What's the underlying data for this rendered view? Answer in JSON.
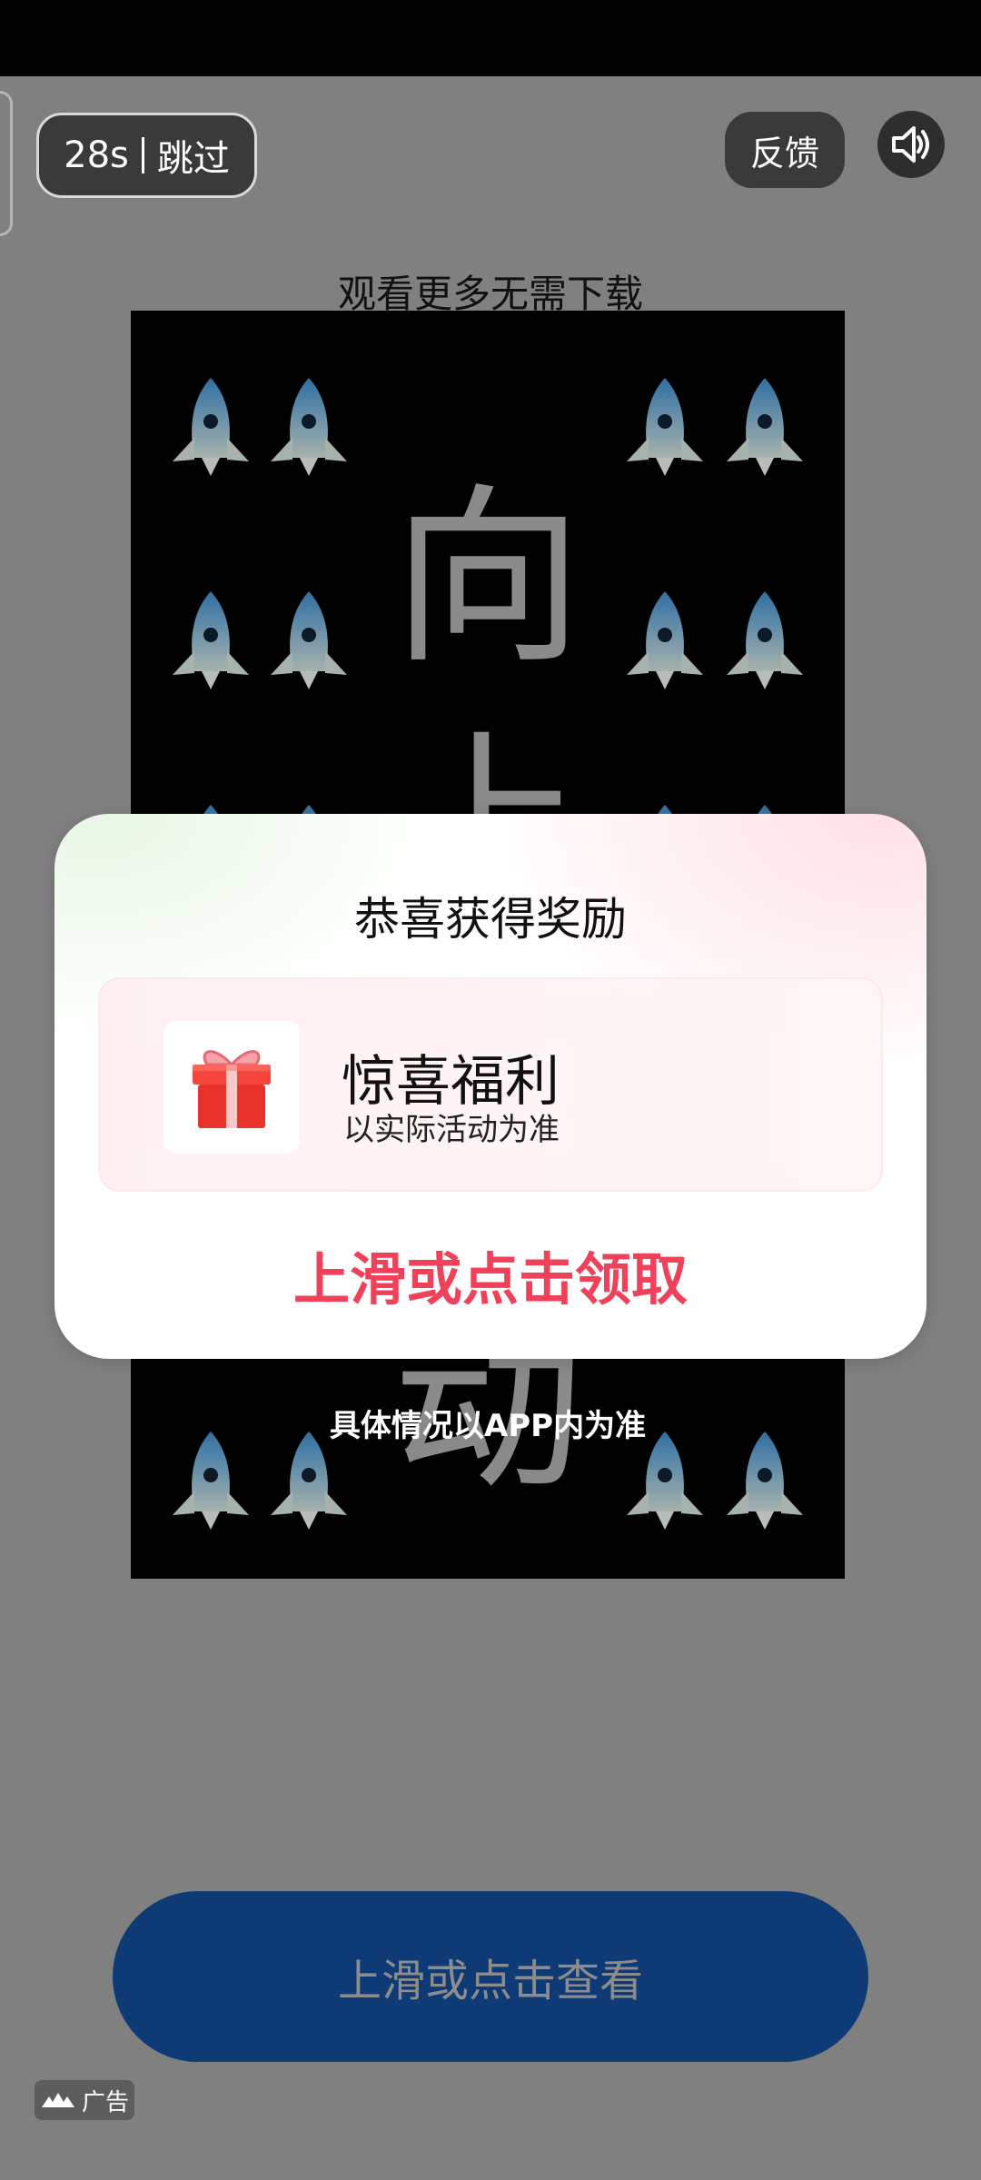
{
  "top_bar": {
    "countdown": "28s",
    "skip_label": "跳过",
    "feedback_label": "反馈",
    "sound_icon": "speaker-icon"
  },
  "watch_more_text": "观看更多无需下载",
  "video": {
    "big_chars": [
      "向",
      "上",
      "动"
    ],
    "note": "具体情况以APP内为准",
    "decoration_icon": "rocket-icon"
  },
  "modal": {
    "title": "恭喜获得奖励",
    "reward_name": "惊喜福利",
    "reward_desc": "以实际活动为准",
    "reward_icon": "gift-icon",
    "claim_text": "上滑或点击领取"
  },
  "cta_label": "上滑或点击查看",
  "ad_label": "广告",
  "colors": {
    "claim": "#f0415a",
    "cta_bg": "#0e3a76",
    "overlay": "#808080"
  }
}
